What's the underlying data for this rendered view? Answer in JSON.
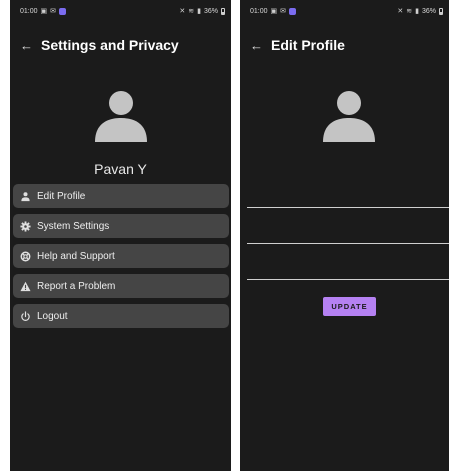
{
  "left_screen": {
    "status_bar": {
      "time": "01:00",
      "battery": "36%"
    },
    "app_bar": {
      "title": "Settings and Privacy",
      "back_icon": "arrow-back-icon"
    },
    "profile": {
      "name": "Pavan Y",
      "avatar_icon": "person-avatar-icon"
    },
    "menu": {
      "items": [
        {
          "label": "Edit Profile",
          "icon": "person-icon"
        },
        {
          "label": "System Settings",
          "icon": "gear-icon"
        },
        {
          "label": "Help and Support",
          "icon": "lifebuoy-icon"
        },
        {
          "label": "Report a Problem",
          "icon": "warning-icon"
        },
        {
          "label": "Logout",
          "icon": "power-icon"
        }
      ]
    }
  },
  "right_screen": {
    "status_bar": {
      "time": "01:00",
      "battery": "36%"
    },
    "app_bar": {
      "title": "Edit Profile",
      "back_icon": "arrow-back-icon"
    },
    "profile": {
      "avatar_icon": "person-avatar-icon"
    },
    "form": {
      "fields": [
        {
          "value": ""
        },
        {
          "value": ""
        },
        {
          "value": ""
        }
      ],
      "update_label": "UPDATE"
    }
  },
  "colors": {
    "background": "#1b1b1b",
    "menu_item": "#454545",
    "avatar": "#c4c4c4",
    "accent_button": "#b581f2"
  }
}
